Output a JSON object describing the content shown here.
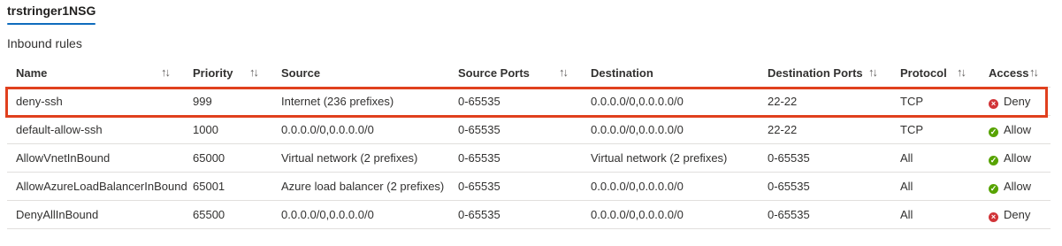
{
  "tab": {
    "label": "trstringer1NSG"
  },
  "section_title": "Inbound rules",
  "columns": [
    {
      "label": "Name",
      "sortable": true
    },
    {
      "label": "Priority",
      "sortable": true
    },
    {
      "label": "Source",
      "sortable": false
    },
    {
      "label": "Source Ports",
      "sortable": true
    },
    {
      "label": "Destination",
      "sortable": false
    },
    {
      "label": "Destination Ports",
      "sortable": true
    },
    {
      "label": "Protocol",
      "sortable": true
    },
    {
      "label": "Access",
      "sortable": true
    }
  ],
  "sort_glyph": "↑↓",
  "rows": [
    {
      "name": "deny-ssh",
      "priority": "999",
      "source": "Internet (236 prefixes)",
      "source_ports": "0-65535",
      "destination": "0.0.0.0/0,0.0.0.0/0",
      "destination_ports": "22-22",
      "protocol": "TCP",
      "access": "Deny",
      "access_icon": "deny-icon",
      "highlighted": true
    },
    {
      "name": "default-allow-ssh",
      "priority": "1000",
      "source": "0.0.0.0/0,0.0.0.0/0",
      "source_ports": "0-65535",
      "destination": "0.0.0.0/0,0.0.0.0/0",
      "destination_ports": "22-22",
      "protocol": "TCP",
      "access": "Allow",
      "access_icon": "allow-icon",
      "highlighted": false
    },
    {
      "name": "AllowVnetInBound",
      "priority": "65000",
      "source": "Virtual network (2 prefixes)",
      "source_ports": "0-65535",
      "destination": "Virtual network (2 prefixes)",
      "destination_ports": "0-65535",
      "protocol": "All",
      "access": "Allow",
      "access_icon": "allow-icon",
      "highlighted": false
    },
    {
      "name": "AllowAzureLoadBalancerInBound",
      "priority": "65001",
      "source": "Azure load balancer (2 prefixes)",
      "source_ports": "0-65535",
      "destination": "0.0.0.0/0,0.0.0.0/0",
      "destination_ports": "0-65535",
      "protocol": "All",
      "access": "Allow",
      "access_icon": "allow-icon",
      "highlighted": false
    },
    {
      "name": "DenyAllInBound",
      "priority": "65500",
      "source": "0.0.0.0/0,0.0.0.0/0",
      "source_ports": "0-65535",
      "destination": "0.0.0.0/0,0.0.0.0/0",
      "destination_ports": "0-65535",
      "protocol": "All",
      "access": "Deny",
      "access_icon": "deny-icon",
      "highlighted": false
    }
  ],
  "colors": {
    "accent": "#0f6cbd",
    "highlight_border": "#e0401e",
    "deny": "#d13438",
    "allow": "#57a300"
  }
}
